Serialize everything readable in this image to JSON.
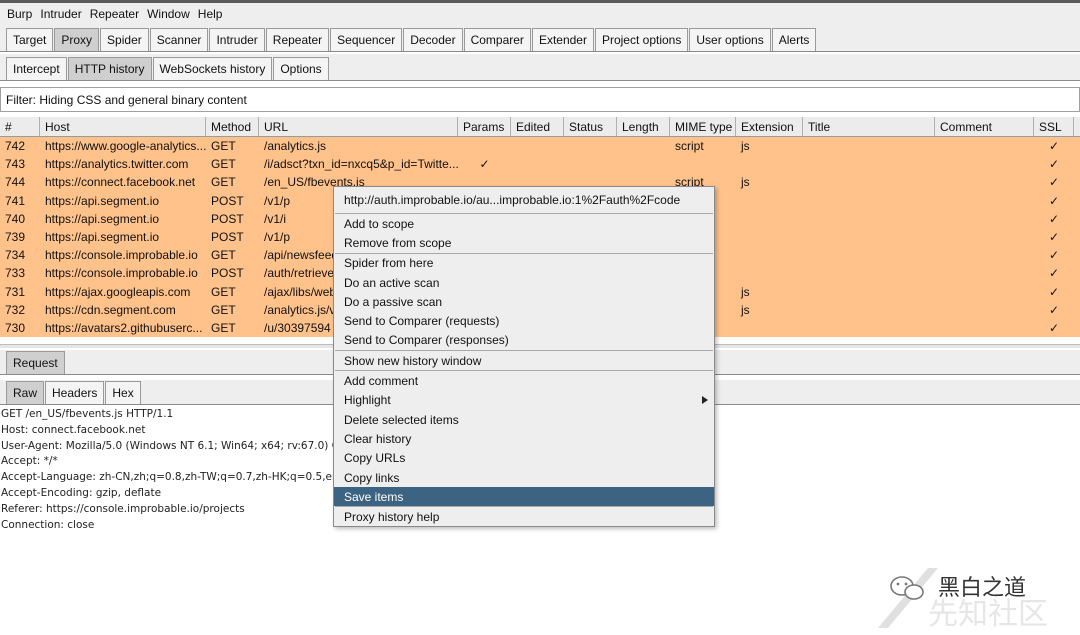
{
  "menu": [
    "Burp",
    "Intruder",
    "Repeater",
    "Window",
    "Help"
  ],
  "main_tabs": [
    "Target",
    "Proxy",
    "Spider",
    "Scanner",
    "Intruder",
    "Repeater",
    "Sequencer",
    "Decoder",
    "Comparer",
    "Extender",
    "Project options",
    "User options",
    "Alerts"
  ],
  "main_tab_active": "Proxy",
  "sub_tabs": [
    "Intercept",
    "HTTP history",
    "WebSockets history",
    "Options"
  ],
  "sub_tab_active": "HTTP history",
  "filter": "Filter: Hiding CSS and general binary content",
  "columns": [
    "#",
    "Host",
    "Method",
    "URL",
    "Params",
    "Edited",
    "Status",
    "Length",
    "MIME type",
    "Extension",
    "Title",
    "Comment",
    "SSL"
  ],
  "rows": [
    {
      "num": "742",
      "host": "https://www.google-analytics...",
      "method": "GET",
      "url": "/analytics.js",
      "params": "",
      "mime": "script",
      "ext": "js",
      "ssl": "✓"
    },
    {
      "num": "743",
      "host": "https://analytics.twitter.com",
      "method": "GET",
      "url": "/i/adsct?txn_id=nxcq5&p_id=Twitte...",
      "params": "✓",
      "mime": "",
      "ext": "",
      "ssl": "✓"
    },
    {
      "num": "744",
      "host": "https://connect.facebook.net",
      "method": "GET",
      "url": "/en_US/fbevents.js",
      "params": "",
      "mime": "script",
      "ext": "js",
      "ssl": "✓"
    },
    {
      "num": "741",
      "host": "https://api.segment.io",
      "method": "POST",
      "url": "/v1/p",
      "params": "",
      "mime": "",
      "ext": "",
      "ssl": "✓"
    },
    {
      "num": "740",
      "host": "https://api.segment.io",
      "method": "POST",
      "url": "/v1/i",
      "params": "",
      "mime": "",
      "ext": "",
      "ssl": "✓"
    },
    {
      "num": "739",
      "host": "https://api.segment.io",
      "method": "POST",
      "url": "/v1/p",
      "params": "",
      "mime": "",
      "ext": "",
      "ssl": "✓"
    },
    {
      "num": "734",
      "host": "https://console.improbable.io",
      "method": "GET",
      "url": "/api/newsfeed",
      "params": "",
      "mime": "",
      "ext": "",
      "ssl": "✓"
    },
    {
      "num": "733",
      "host": "https://console.improbable.io",
      "method": "POST",
      "url": "/auth/retrieve",
      "params": "",
      "mime": "",
      "ext": "",
      "ssl": "✓"
    },
    {
      "num": "731",
      "host": "https://ajax.googleapis.com",
      "method": "GET",
      "url": "/ajax/libs/webfont",
      "params": "",
      "mime": "",
      "ext": "js",
      "ssl": "✓"
    },
    {
      "num": "732",
      "host": "https://cdn.segment.com",
      "method": "GET",
      "url": "/analytics.js/v1",
      "params": "",
      "mime": "",
      "ext": "js",
      "ssl": "✓"
    },
    {
      "num": "730",
      "host": "https://avatars2.githubuserc...",
      "method": "GET",
      "url": "/u/30397594",
      "params": "",
      "mime": "",
      "ext": "",
      "ssl": "✓"
    }
  ],
  "request_tab": "Request",
  "raw_tabs": [
    "Raw",
    "Headers",
    "Hex"
  ],
  "raw_lines": [
    "GET /en_US/fbevents.js HTTP/1.1",
    "Host: connect.facebook.net",
    "User-Agent: Mozilla/5.0 (Windows NT 6.1; Win64; x64; rv:67.0) Gecko",
    "Accept: */*",
    "Accept-Language: zh-CN,zh;q=0.8,zh-TW;q=0.7,zh-HK;q=0.5,en-US;",
    "Accept-Encoding: gzip, deflate",
    "Referer: https://console.improbable.io/projects",
    "Connection: close"
  ],
  "context_menu": {
    "url": "http://auth.improbable.io/au...improbable.io:1%2Fauth%2Fcode",
    "g1": [
      "Add to scope",
      "Remove from scope"
    ],
    "g2": [
      "Spider from here",
      "Do an active scan",
      "Do a passive scan",
      "Send to Comparer (requests)",
      "Send to Comparer (responses)"
    ],
    "g3": [
      "Show new history window"
    ],
    "g4": [
      "Add comment",
      "Highlight",
      "Delete selected items",
      "Clear history",
      "Copy URLs",
      "Copy links",
      "Save items"
    ],
    "g5": [
      "Proxy history help"
    ],
    "highlighted": "Save items"
  },
  "watermark": {
    "text": "黑白之道",
    "bg_text": "先知社区"
  },
  "colors": {
    "row_bg": "#ffc28a",
    "menu_highlight": "#3c6482",
    "active_tab": "#cfcfcf"
  }
}
